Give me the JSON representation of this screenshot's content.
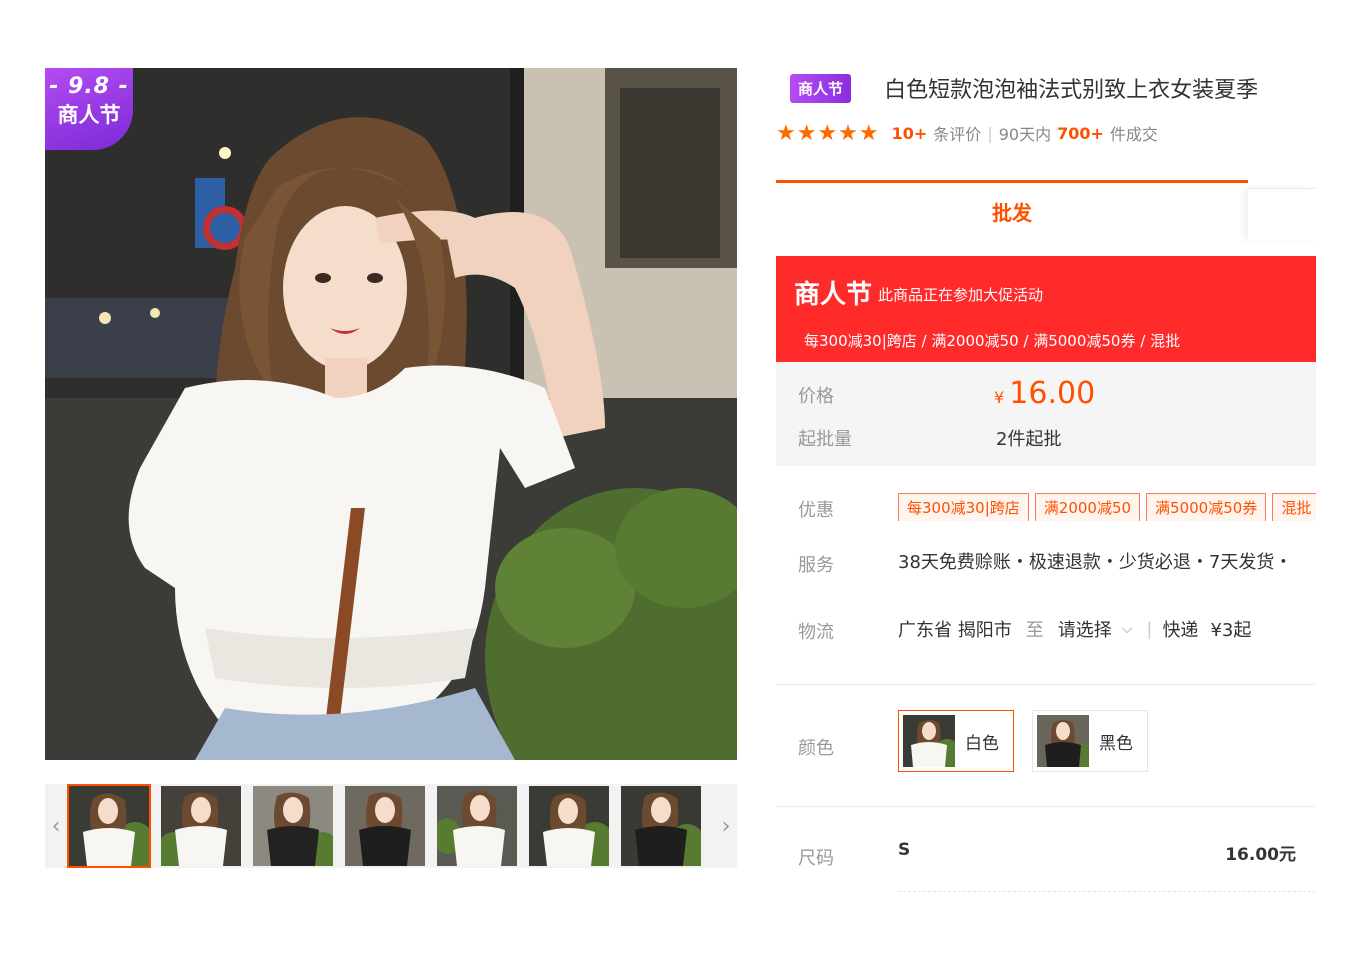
{
  "gallery": {
    "badge_date": "- 9.8 -",
    "badge_name": "商人节",
    "prev_arrow": "‹",
    "next_arrow": "›",
    "thumbnail_count": 7
  },
  "product": {
    "tag": "商人节",
    "title": "白色短款泡泡袖法式别致上衣女装夏季",
    "stars": "★★★★★",
    "review_count": "10+",
    "review_label": "条评价",
    "sales_period": "90天内",
    "sales_count": "700+",
    "sales_label": "件成交"
  },
  "tabs": {
    "active": "批发"
  },
  "promo": {
    "logo": "商人节",
    "description": "此商品正在参加大促活动",
    "rules": "每300减30|跨店 / 满2000减50 / 满5000减50券 / 混批"
  },
  "pricing": {
    "price_label": "价格",
    "currency": "¥",
    "price": "16.00",
    "moq_label": "起批量",
    "moq": "2件起批"
  },
  "offers": {
    "label": "优惠",
    "coupons": [
      "每300减30|跨店",
      "满2000减50",
      "满5000减50券",
      "混批"
    ]
  },
  "service": {
    "label": "服务",
    "text": "38天免费赊账・极速退款・少货必退・7天发货・"
  },
  "logistics": {
    "label": "物流",
    "origin": "广东省 揭阳市",
    "to": "至",
    "destination": "请选择",
    "method": "快递",
    "fee": "¥3起"
  },
  "colors": {
    "label": "颜色",
    "options": [
      {
        "name": "白色",
        "selected": true
      },
      {
        "name": "黑色",
        "selected": false
      }
    ]
  },
  "sizes": {
    "label": "尺码",
    "rows": [
      {
        "size": "S",
        "price": "16.00元"
      }
    ]
  },
  "theme": {
    "accent": "#ff5000",
    "promo_red": "#ff2a2a",
    "badge_purple": "#9b3ee8"
  }
}
